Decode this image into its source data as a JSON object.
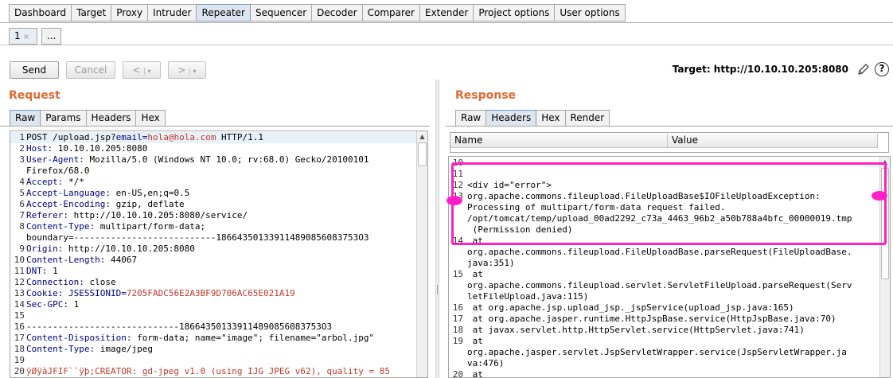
{
  "tool_tabs": [
    "Dashboard",
    "Target",
    "Proxy",
    "Intruder",
    "Repeater",
    "Sequencer",
    "Decoder",
    "Comparer",
    "Extender",
    "Project options",
    "User options"
  ],
  "active_tool_tab": "Repeater",
  "repeater_tabs": {
    "current": "1",
    "close_glyph": "×",
    "more": "..."
  },
  "toolbar": {
    "send": "Send",
    "cancel": "Cancel",
    "back": "<",
    "forward": ">",
    "dropdown": "▾",
    "target": "Target: http://10.10.10.205:8080"
  },
  "request": {
    "title": "Request",
    "tabs": [
      "Raw",
      "Params",
      "Headers",
      "Hex"
    ],
    "active_tab": "Raw",
    "lines": [
      {
        "n": "1",
        "text": "POST /upload.jsp?email=hola@hola.com HTTP/1.1"
      },
      {
        "n": "2",
        "text": "Host: 10.10.10.205:8080"
      },
      {
        "n": "3",
        "text": "User-Agent: Mozilla/5.0 (Windows NT 10.0; rv:68.0) Gecko/20100101"
      },
      {
        "n": "",
        "text": "Firefox/68.0"
      },
      {
        "n": "4",
        "text": "Accept: */*"
      },
      {
        "n": "5",
        "text": "Accept-Language: en-US,en;q=0.5"
      },
      {
        "n": "6",
        "text": "Accept-Encoding: gzip, deflate"
      },
      {
        "n": "7",
        "text": "Referer: http://10.10.10.205:8080/service/"
      },
      {
        "n": "8",
        "text": "Content-Type: multipart/form-data;"
      },
      {
        "n": "",
        "text": "boundary=---------------------------186643501339114890856083753O3"
      },
      {
        "n": "9",
        "text": "Origin: http://10.10.10.205:8080"
      },
      {
        "n": "10",
        "text": "Content-Length: 44067"
      },
      {
        "n": "11",
        "text": "DNT: 1"
      },
      {
        "n": "12",
        "text": "Connection: close"
      },
      {
        "n": "13",
        "text": "Cookie: JSESSIONID=7205FADC56E2A3BF9D706AC65E021A19"
      },
      {
        "n": "14",
        "text": "Sec-GPC: 1"
      },
      {
        "n": "15",
        "text": ""
      },
      {
        "n": "16",
        "text": "-----------------------------186643501339114890856083753O3"
      },
      {
        "n": "17",
        "text": "Content-Disposition: form-data; name=\"image\"; filename=\"arbol.jpg\""
      },
      {
        "n": "18",
        "text": "Content-Type: image/jpeg"
      },
      {
        "n": "19",
        "text": ""
      },
      {
        "n": "20",
        "text": "ÿØÿàJFIF``ÿþ;CREATOR: gd-jpeg v1.0 (using IJG JPEG v62), quality = 85"
      }
    ]
  },
  "response": {
    "title": "Response",
    "tabs": [
      "Raw",
      "Headers",
      "Hex",
      "Render"
    ],
    "active_tab": "Headers",
    "table_headers": [
      "Name",
      "Value"
    ],
    "lines": [
      {
        "n": "10",
        "text": ""
      },
      {
        "n": "11",
        "text": ""
      },
      {
        "n": "12",
        "text": "<div id=\"error\">"
      },
      {
        "n": "13",
        "text": "org.apache.commons.fileupload.FileUploadBase$IOFileUploadException:"
      },
      {
        "n": "",
        "text": "Processing of multipart/form-data request failed."
      },
      {
        "n": "",
        "text": "/opt/tomcat/temp/upload_00ad2292_c73a_4463_96b2_a50b788a4bfc_00000019.tmp"
      },
      {
        "n": "",
        "text": " (Permission denied)"
      },
      {
        "n": "14",
        "text": " at"
      },
      {
        "n": "",
        "text": "org.apache.commons.fileupload.FileUploadBase.parseRequest(FileUploadBase."
      },
      {
        "n": "",
        "text": "java:351)"
      },
      {
        "n": "15",
        "text": " at"
      },
      {
        "n": "",
        "text": "org.apache.commons.fileupload.servlet.ServletFileUpload.parseRequest(Serv"
      },
      {
        "n": "",
        "text": "letFileUpload.java:115)"
      },
      {
        "n": "16",
        "text": " at org.apache.jsp.upload_jsp._jspService(upload_jsp.java:165)"
      },
      {
        "n": "17",
        "text": " at org.apache.jasper.runtime.HttpJspBase.service(HttpJspBase.java:70)"
      },
      {
        "n": "18",
        "text": " at javax.servlet.http.HttpServlet.service(HttpServlet.java:741)"
      },
      {
        "n": "19",
        "text": " at"
      },
      {
        "n": "",
        "text": "org.apache.jasper.servlet.JspServletWrapper.service(JspServletWrapper.ja"
      },
      {
        "n": "",
        "text": "va:476)"
      },
      {
        "n": "20",
        "text": " at"
      }
    ]
  },
  "colors": {
    "accent": "#e06b33",
    "annotation": "#ff1ec8",
    "header_name": "#000080",
    "param_value": "#c0392b"
  },
  "icons": {
    "edit": "pencil-icon",
    "help": "help-icon"
  }
}
